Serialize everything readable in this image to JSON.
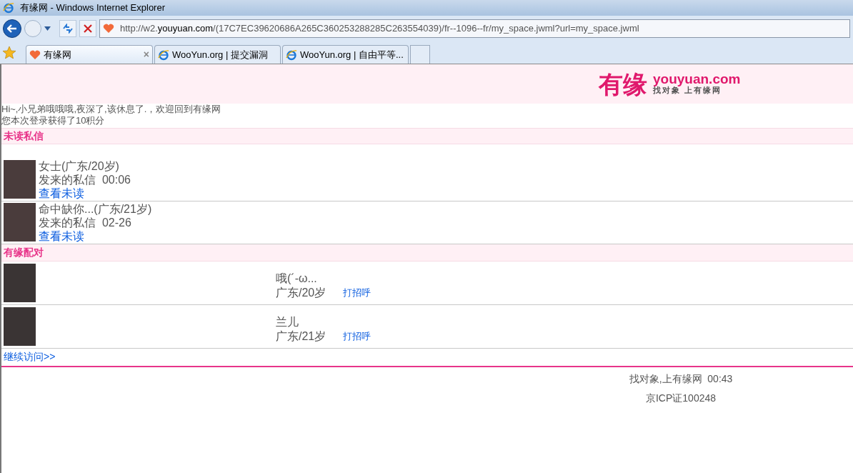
{
  "window": {
    "title": "有缘网 - Windows Internet Explorer"
  },
  "address_bar": {
    "url_prefix": "http://w2.",
    "url_domain": "youyuan.com",
    "url_rest": "/(17C7EC39620686A265C360253288285C263554039)/fr--1096--fr/my_space.jwml?url=my_space.jwml"
  },
  "tab_close": "×",
  "tabs": [
    {
      "label": "有缘网",
      "selected": true,
      "kind": "heart"
    },
    {
      "label": "WooYun.org | 提交漏洞",
      "selected": false,
      "kind": "ie"
    },
    {
      "label": "WooYun.org | 自由平等...",
      "selected": false,
      "kind": "ie"
    }
  ],
  "logo": {
    "mark": "有缘",
    "domain": "youyuan.com",
    "slogan": "找对象 上有缘网"
  },
  "greeting": [
    "Hi~,小兄弟哦哦哦,夜深了,该休息了.，欢迎回到有缘网",
    "您本次登录获得了10积分"
  ],
  "unread_section": {
    "title": "未读私信",
    "messages": [
      {
        "name": "女士(广东/20岁)",
        "info": "发来的私信  00:06",
        "link": "查看未读"
      },
      {
        "name": "命中缺你...(广东/21岁)",
        "info": "发来的私信  02-26",
        "link": "查看未读"
      }
    ]
  },
  "match_section": {
    "title": "有缘配对",
    "matches": [
      {
        "name": "哦(´-ω...",
        "info": "广东/20岁",
        "action": "打招呼"
      },
      {
        "name": "兰儿",
        "info": "广东/21岁",
        "action": "打招呼"
      }
    ],
    "more_link": "继续访问>>"
  },
  "footer": [
    "找对象,上有缘网  00:43",
    "京ICP证100248"
  ]
}
